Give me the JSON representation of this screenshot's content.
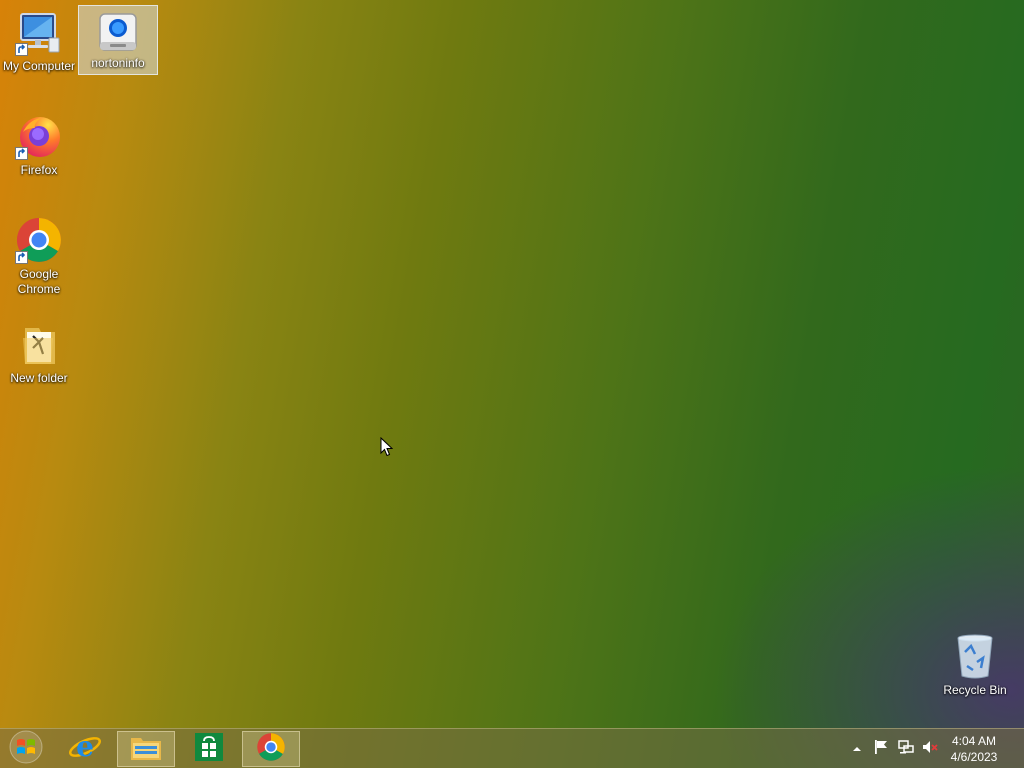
{
  "desktop": {
    "icons": [
      {
        "name": "my-computer",
        "label": "My Computer",
        "icon": "computer-monitor-icon"
      },
      {
        "name": "nortoninfo",
        "label": "nortoninfo",
        "icon": "norton-drive-icon",
        "selected": true
      },
      {
        "name": "firefox",
        "label": "Firefox",
        "icon": "firefox-icon"
      },
      {
        "name": "google-chrome",
        "label": "Google\nChrome",
        "icon": "chrome-icon"
      },
      {
        "name": "new-folder",
        "label": "New folder",
        "icon": "folder-icon"
      },
      {
        "name": "recycle-bin",
        "label": "Recycle Bin",
        "icon": "recycle-bin-icon"
      }
    ]
  },
  "taskbar": {
    "start": {
      "icon": "windows-start-icon"
    },
    "pinned": [
      {
        "name": "internet-explorer",
        "icon": "internet-explorer-icon"
      },
      {
        "name": "file-explorer",
        "icon": "file-explorer-icon",
        "active": true
      },
      {
        "name": "windows-store",
        "icon": "store-icon"
      },
      {
        "name": "google-chrome",
        "icon": "chrome-icon",
        "active": true
      }
    ],
    "tray": {
      "icons": [
        "show-hidden-icons-chevron-icon",
        "action-center-flag-icon",
        "network-icon",
        "volume-muted-icon"
      ]
    },
    "clock": {
      "time": "4:04 AM",
      "date": "4/6/2023"
    }
  },
  "colors": {
    "wallpaper_left": "#d88208",
    "wallpaper_right": "#2d6323",
    "wallpaper_corner": "#4a3470"
  }
}
